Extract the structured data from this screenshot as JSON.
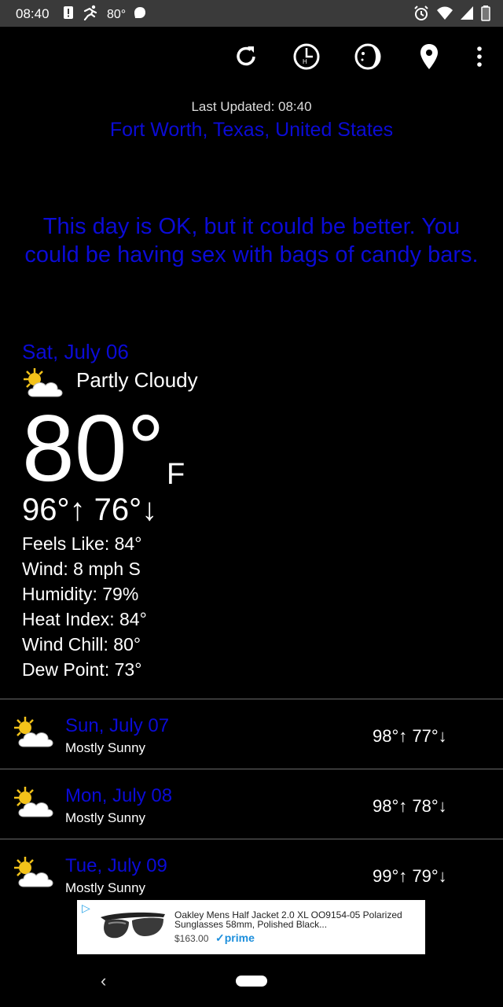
{
  "status_bar": {
    "time": "08:40",
    "temp": "80°",
    "icons": [
      "alert-icon",
      "run-icon",
      "bubble-icon",
      "alarm-icon",
      "wifi-icon",
      "signal-icon",
      "battery-icon"
    ]
  },
  "toolbar": {
    "buttons": [
      "refresh-icon",
      "hourly-icon",
      "moon-icon",
      "location-icon",
      "more-icon"
    ]
  },
  "header": {
    "last_updated": "Last Updated: 08:40",
    "location": "Fort Worth, Texas, United States"
  },
  "message": "This day is OK, but it could be better. You could be having sex with bags of candy bars.",
  "today": {
    "date": "Sat, July 06",
    "condition": "Partly Cloudy",
    "temp": "80°",
    "unit": "F",
    "hilo": "96°↑ 76°↓",
    "details": [
      "Feels Like: 84°",
      "Wind: 8 mph S",
      "Humidity: 79%",
      "Heat Index: 84°",
      "Wind Chill: 80°",
      "Dew Point: 73°"
    ]
  },
  "forecast": [
    {
      "date": "Sun, July 07",
      "condition": "Mostly Sunny",
      "hilo": "98°↑ 77°↓"
    },
    {
      "date": "Mon, July 08",
      "condition": "Mostly Sunny",
      "hilo": "98°↑ 78°↓"
    },
    {
      "date": "Tue, July 09",
      "condition": "Mostly Sunny",
      "hilo": "99°↑ 79°↓"
    }
  ],
  "ad": {
    "badge": "▷",
    "title": "Oakley Mens Half Jacket 2.0 XL OO9154-05 Polarized Sunglasses 58mm, Polished Black...",
    "price": "$163.00",
    "prime": "✓prime"
  },
  "colors": {
    "accent_blue": "#0b0bd6",
    "background": "#000000",
    "statusbar": "#3a3a3a"
  }
}
